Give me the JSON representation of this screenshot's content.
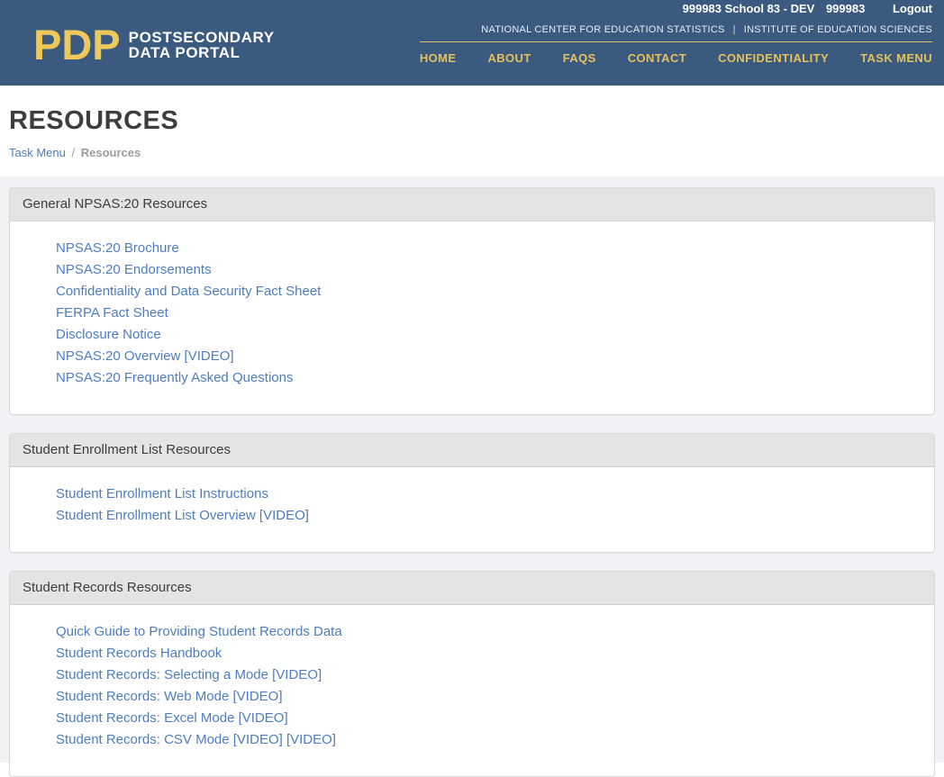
{
  "topbar": {
    "school_label": "999983 School 83 - DEV",
    "school_id": "999983",
    "logout_label": "Logout"
  },
  "header": {
    "logo_acronym": "PDP",
    "logo_line1": "POSTSECONDARY",
    "logo_line2": "DATA PORTAL",
    "org_left": "NATIONAL CENTER FOR EDUCATION STATISTICS",
    "org_separator": "|",
    "org_right": "INSTITUTE OF EDUCATION SCIENCES",
    "nav": [
      {
        "label": "HOME"
      },
      {
        "label": "ABOUT"
      },
      {
        "label": "FAQS"
      },
      {
        "label": "CONTACT"
      },
      {
        "label": "CONFIDENTIALITY"
      },
      {
        "label": "TASK MENU"
      }
    ]
  },
  "page": {
    "title": "RESOURCES",
    "breadcrumb": {
      "link_label": "Task Menu",
      "separator": "/",
      "current": "Resources"
    }
  },
  "sections": [
    {
      "title": "General NPSAS:20 Resources",
      "links": [
        "NPSAS:20 Brochure",
        "NPSAS:20 Endorsements",
        "Confidentiality and Data Security Fact Sheet",
        "FERPA Fact Sheet",
        "Disclosure Notice",
        "NPSAS:20 Overview [VIDEO]",
        "NPSAS:20 Frequently Asked Questions"
      ]
    },
    {
      "title": "Student Enrollment List Resources",
      "links": [
        "Student Enrollment List Instructions",
        "Student Enrollment List Overview [VIDEO]"
      ]
    },
    {
      "title": "Student Records Resources",
      "links": [
        "Quick Guide to Providing Student Records Data",
        "Student Records Handbook",
        "Student Records: Selecting a Mode [VIDEO]",
        "Student Records: Web Mode [VIDEO]",
        "Student Records: Excel Mode [VIDEO]",
        "Student Records: CSV Mode [VIDEO] [VIDEO]"
      ]
    }
  ],
  "colors": {
    "header_background": "#3a5b7f",
    "brand_gold": "#eec85a",
    "nav_gold": "#e6c05c",
    "link_blue": "#4e7dbf",
    "panel_header_background": "#e4e4e3",
    "page_background": "#f1f2f6",
    "title_text": "#3d3d3d",
    "muted_text": "#9b9b9b"
  }
}
